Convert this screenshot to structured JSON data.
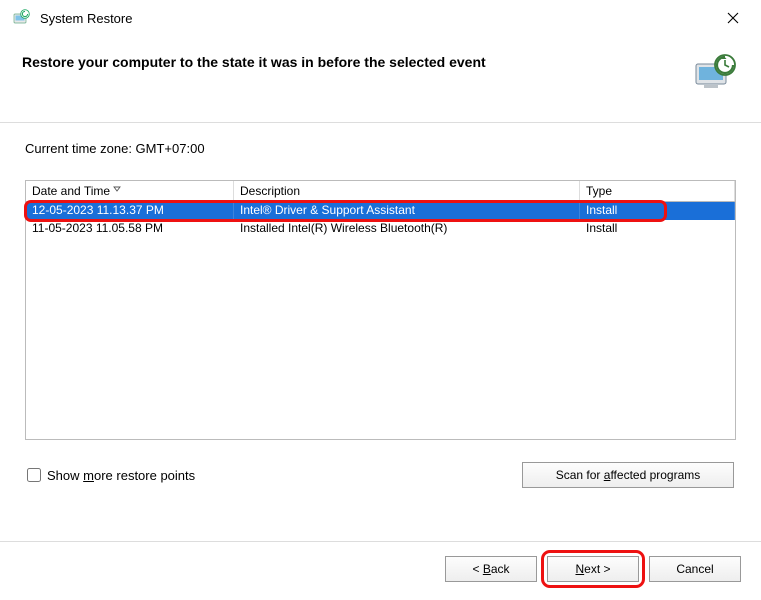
{
  "titlebar": {
    "title": "System Restore"
  },
  "header": {
    "instruction": "Restore your computer to the state it was in before the selected event"
  },
  "body": {
    "timezone_label": "Current time zone: GMT+07:00",
    "columns": {
      "date": "Date and Time",
      "desc": "Description",
      "type": "Type"
    },
    "restore_points": [
      {
        "date": "12-05-2023 11.13.37 PM",
        "desc": "Intel® Driver & Support Assistant",
        "type": "Install",
        "selected": true
      },
      {
        "date": "11-05-2023 11.05.58 PM",
        "desc": "Installed Intel(R) Wireless Bluetooth(R)",
        "type": "Install",
        "selected": false
      }
    ]
  },
  "controls": {
    "show_more_pre": "Show ",
    "show_more_ul": "m",
    "show_more_post": "ore restore points",
    "scan_pre": "Scan for ",
    "scan_ul": "a",
    "scan_post": "ffected programs"
  },
  "footer": {
    "back_pre": "< ",
    "back_ul": "B",
    "back_post": "ack",
    "next_ul": "N",
    "next_post": "ext >",
    "cancel": "Cancel"
  }
}
